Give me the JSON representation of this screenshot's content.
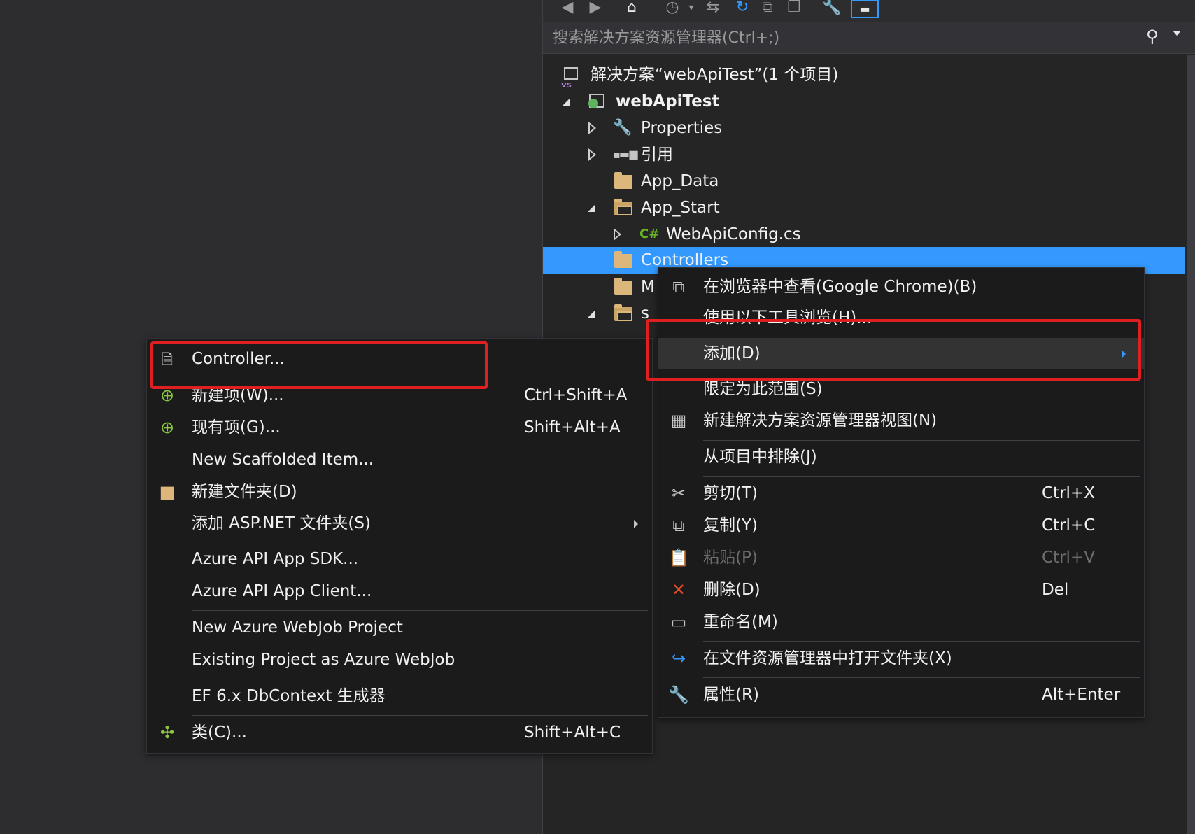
{
  "search": {
    "placeholder": "搜索解决方案资源管理器(Ctrl+;)"
  },
  "tree": [
    {
      "label": "解决方案“webApiTest”(1 个项目)",
      "bold": false
    },
    {
      "label": "webApiTest",
      "bold": true
    },
    {
      "label": "Properties"
    },
    {
      "label": "引用"
    },
    {
      "label": "App_Data"
    },
    {
      "label": "App_Start"
    },
    {
      "label": "WebApiConfig.cs"
    },
    {
      "label": "Controllers"
    },
    {
      "label": "M"
    },
    {
      "label": "s"
    }
  ],
  "context_menu": {
    "items": [
      {
        "label": "在浏览器中查看(Google Chrome)(B)",
        "shortcut": ""
      },
      {
        "label": "使用以下工具浏览(H)...",
        "shortcut": ""
      },
      {
        "label": "添加(D)",
        "shortcut": ""
      },
      {
        "label": "限定为此范围(S)",
        "shortcut": ""
      },
      {
        "label": "新建解决方案资源管理器视图(N)",
        "shortcut": ""
      },
      {
        "label": "从项目中排除(J)",
        "shortcut": ""
      },
      {
        "label": "剪切(T)",
        "shortcut": "Ctrl+X"
      },
      {
        "label": "复制(Y)",
        "shortcut": "Ctrl+C"
      },
      {
        "label": "粘贴(P)",
        "shortcut": "Ctrl+V"
      },
      {
        "label": "删除(D)",
        "shortcut": "Del"
      },
      {
        "label": "重命名(M)",
        "shortcut": ""
      },
      {
        "label": "在文件资源管理器中打开文件夹(X)",
        "shortcut": ""
      },
      {
        "label": "属性(R)",
        "shortcut": "Alt+Enter"
      }
    ]
  },
  "add_submenu": {
    "items": [
      {
        "label": "Controller...",
        "shortcut": ""
      },
      {
        "label": "新建项(W)...",
        "shortcut": "Ctrl+Shift+A"
      },
      {
        "label": "现有项(G)...",
        "shortcut": "Shift+Alt+A"
      },
      {
        "label": "New Scaffolded Item...",
        "shortcut": ""
      },
      {
        "label": "新建文件夹(D)",
        "shortcut": ""
      },
      {
        "label": "添加 ASP.NET 文件夹(S)",
        "shortcut": ""
      },
      {
        "label": "Azure API App SDK...",
        "shortcut": ""
      },
      {
        "label": "Azure API App Client...",
        "shortcut": ""
      },
      {
        "label": "New Azure WebJob Project",
        "shortcut": ""
      },
      {
        "label": "Existing Project as Azure WebJob",
        "shortcut": ""
      },
      {
        "label": "EF 6.x DbContext 生成器",
        "shortcut": ""
      },
      {
        "label": "类(C)...",
        "shortcut": "Shift+Alt+C"
      }
    ]
  },
  "colors": {
    "selection": "#3399ff",
    "highlight_box": "#e02020",
    "menu_bg": "#1b1b1c",
    "panel_bg": "#252526"
  }
}
